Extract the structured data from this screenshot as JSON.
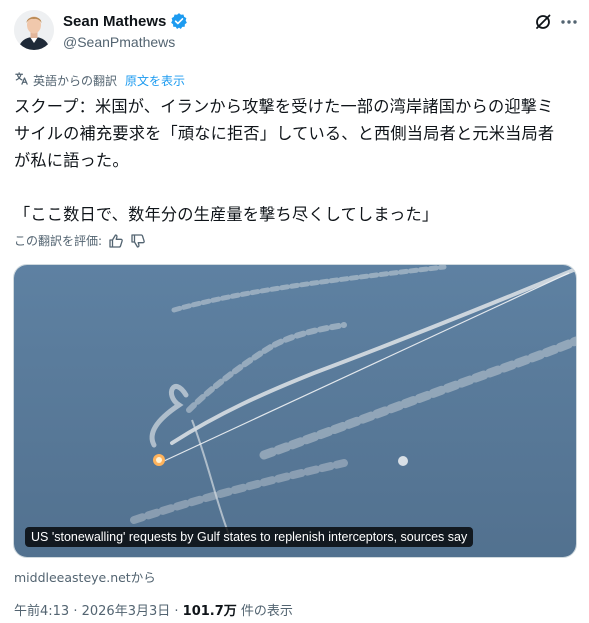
{
  "author": {
    "display_name": "Sean Mathews",
    "handle": "@SeanPmathews",
    "verified": true
  },
  "header_actions": {
    "grok_icon": "grok-slash-icon",
    "more_icon": "more-horizontal-icon"
  },
  "translation": {
    "label": "英語からの翻訳",
    "show_original": "原文を表示",
    "icon": "translate-icon"
  },
  "tweet": {
    "lines": [
      "スクープ：米国が、イランから攻撃を受けた一部の湾岸諸国からの迎撃ミ",
      "サイルの補充要求を「頑なに拒否」している、と西側当局者と元米当局者",
      "が私に語った。",
      "「ここ数日で、数年分の生産量を撃ち尽くしてしまった」"
    ]
  },
  "rating": {
    "label": "この翻訳を評価:",
    "thumbs_up_icon": "thumbs-up-icon",
    "thumbs_down_icon": "thumbs-down-icon"
  },
  "media": {
    "caption": "US 'stonewalling' requests by Gulf states to replenish interceptors, sources say",
    "sky_color": "#5a7c9c"
  },
  "link_source": "middleeasteye.netから",
  "meta": {
    "time": "午前4:13",
    "separator": " · ",
    "date": "2026年3月3日",
    "views_count": "101.7万",
    "views_label": " 件の表示"
  }
}
